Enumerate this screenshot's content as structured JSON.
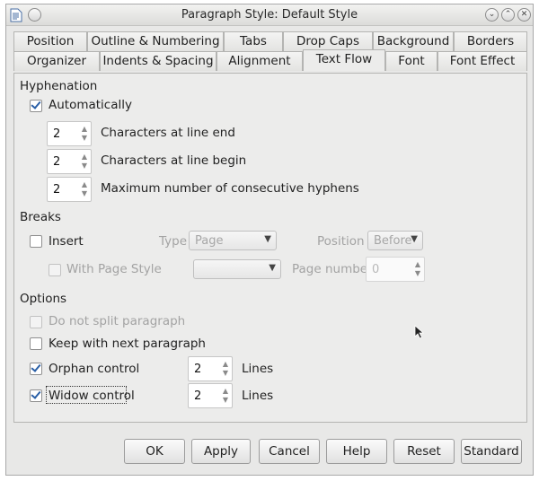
{
  "window": {
    "title": "Paragraph Style: Default Style"
  },
  "tabs": {
    "row1": [
      "Position",
      "Outline & Numbering",
      "Tabs",
      "Drop Caps",
      "Background",
      "Borders"
    ],
    "row2": [
      "Organizer",
      "Indents & Spacing",
      "Alignment",
      "Text Flow",
      "Font",
      "Font Effect"
    ],
    "active": "Text Flow"
  },
  "hyphenation": {
    "heading": "Hyphenation",
    "automatically_label": "Automatically",
    "automatically_checked": true,
    "chars_end_value": "2",
    "chars_end_label": "Characters at line end",
    "chars_begin_value": "2",
    "chars_begin_label": "Characters at line begin",
    "max_hyphens_value": "2",
    "max_hyphens_label": "Maximum number of consecutive hyphens"
  },
  "breaks": {
    "heading": "Breaks",
    "insert_label": "Insert",
    "insert_checked": false,
    "type_label": "Type",
    "type_value": "Page",
    "position_label": "Position",
    "position_value": "Before",
    "with_page_style_label": "With Page Style",
    "page_style_value": "",
    "page_number_label": "Page number",
    "page_number_value": "0"
  },
  "options": {
    "heading": "Options",
    "do_not_split_label": "Do not split paragraph",
    "keep_with_next_label": "Keep with next paragraph",
    "orphan_label": "Orphan control",
    "orphan_checked": true,
    "orphan_value": "2",
    "orphan_unit": "Lines",
    "widow_label": "Widow control",
    "widow_checked": true,
    "widow_value": "2",
    "widow_unit": "Lines"
  },
  "buttons": {
    "ok": "OK",
    "apply": "Apply",
    "cancel": "Cancel",
    "help": "Help",
    "reset": "Reset",
    "standard": "Standard"
  }
}
